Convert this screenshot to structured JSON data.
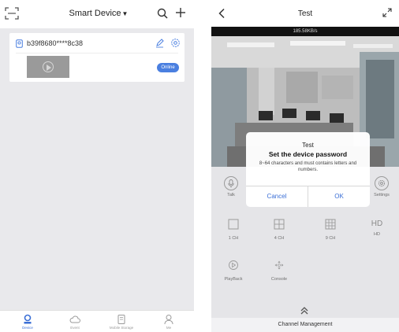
{
  "left": {
    "header": {
      "title": "Smart Device",
      "caret": "▼"
    },
    "device": {
      "id": "b39f8680****8c38",
      "status": "Online"
    },
    "tabs": [
      {
        "label": "Device",
        "icon": "device-icon",
        "active": true
      },
      {
        "label": "Event",
        "icon": "cloud-icon",
        "active": false
      },
      {
        "label": "Mobile Storage",
        "icon": "storage-icon",
        "active": false
      },
      {
        "label": "Me",
        "icon": "user-icon",
        "active": false
      }
    ]
  },
  "right": {
    "header": {
      "title": "Test"
    },
    "speed": "185.58KB/s",
    "controls": {
      "talk": "Talk",
      "settings": "Settings",
      "layouts": [
        "1 CH",
        "4 CH",
        "9 CH",
        "HD"
      ],
      "hd_icon_text": "HD",
      "playback": "PlayBack",
      "console": "Console"
    },
    "channel_management": "Channel Management",
    "dialog": {
      "title": "Test",
      "heading": "Set the device password",
      "description": "8~64 characters and must contains letters and numbers.",
      "cancel": "Cancel",
      "ok": "OK"
    }
  },
  "colors": {
    "accent": "#3b6fd6",
    "online_badge": "#4a7fe0",
    "list_bg": "#e9e9ec"
  }
}
